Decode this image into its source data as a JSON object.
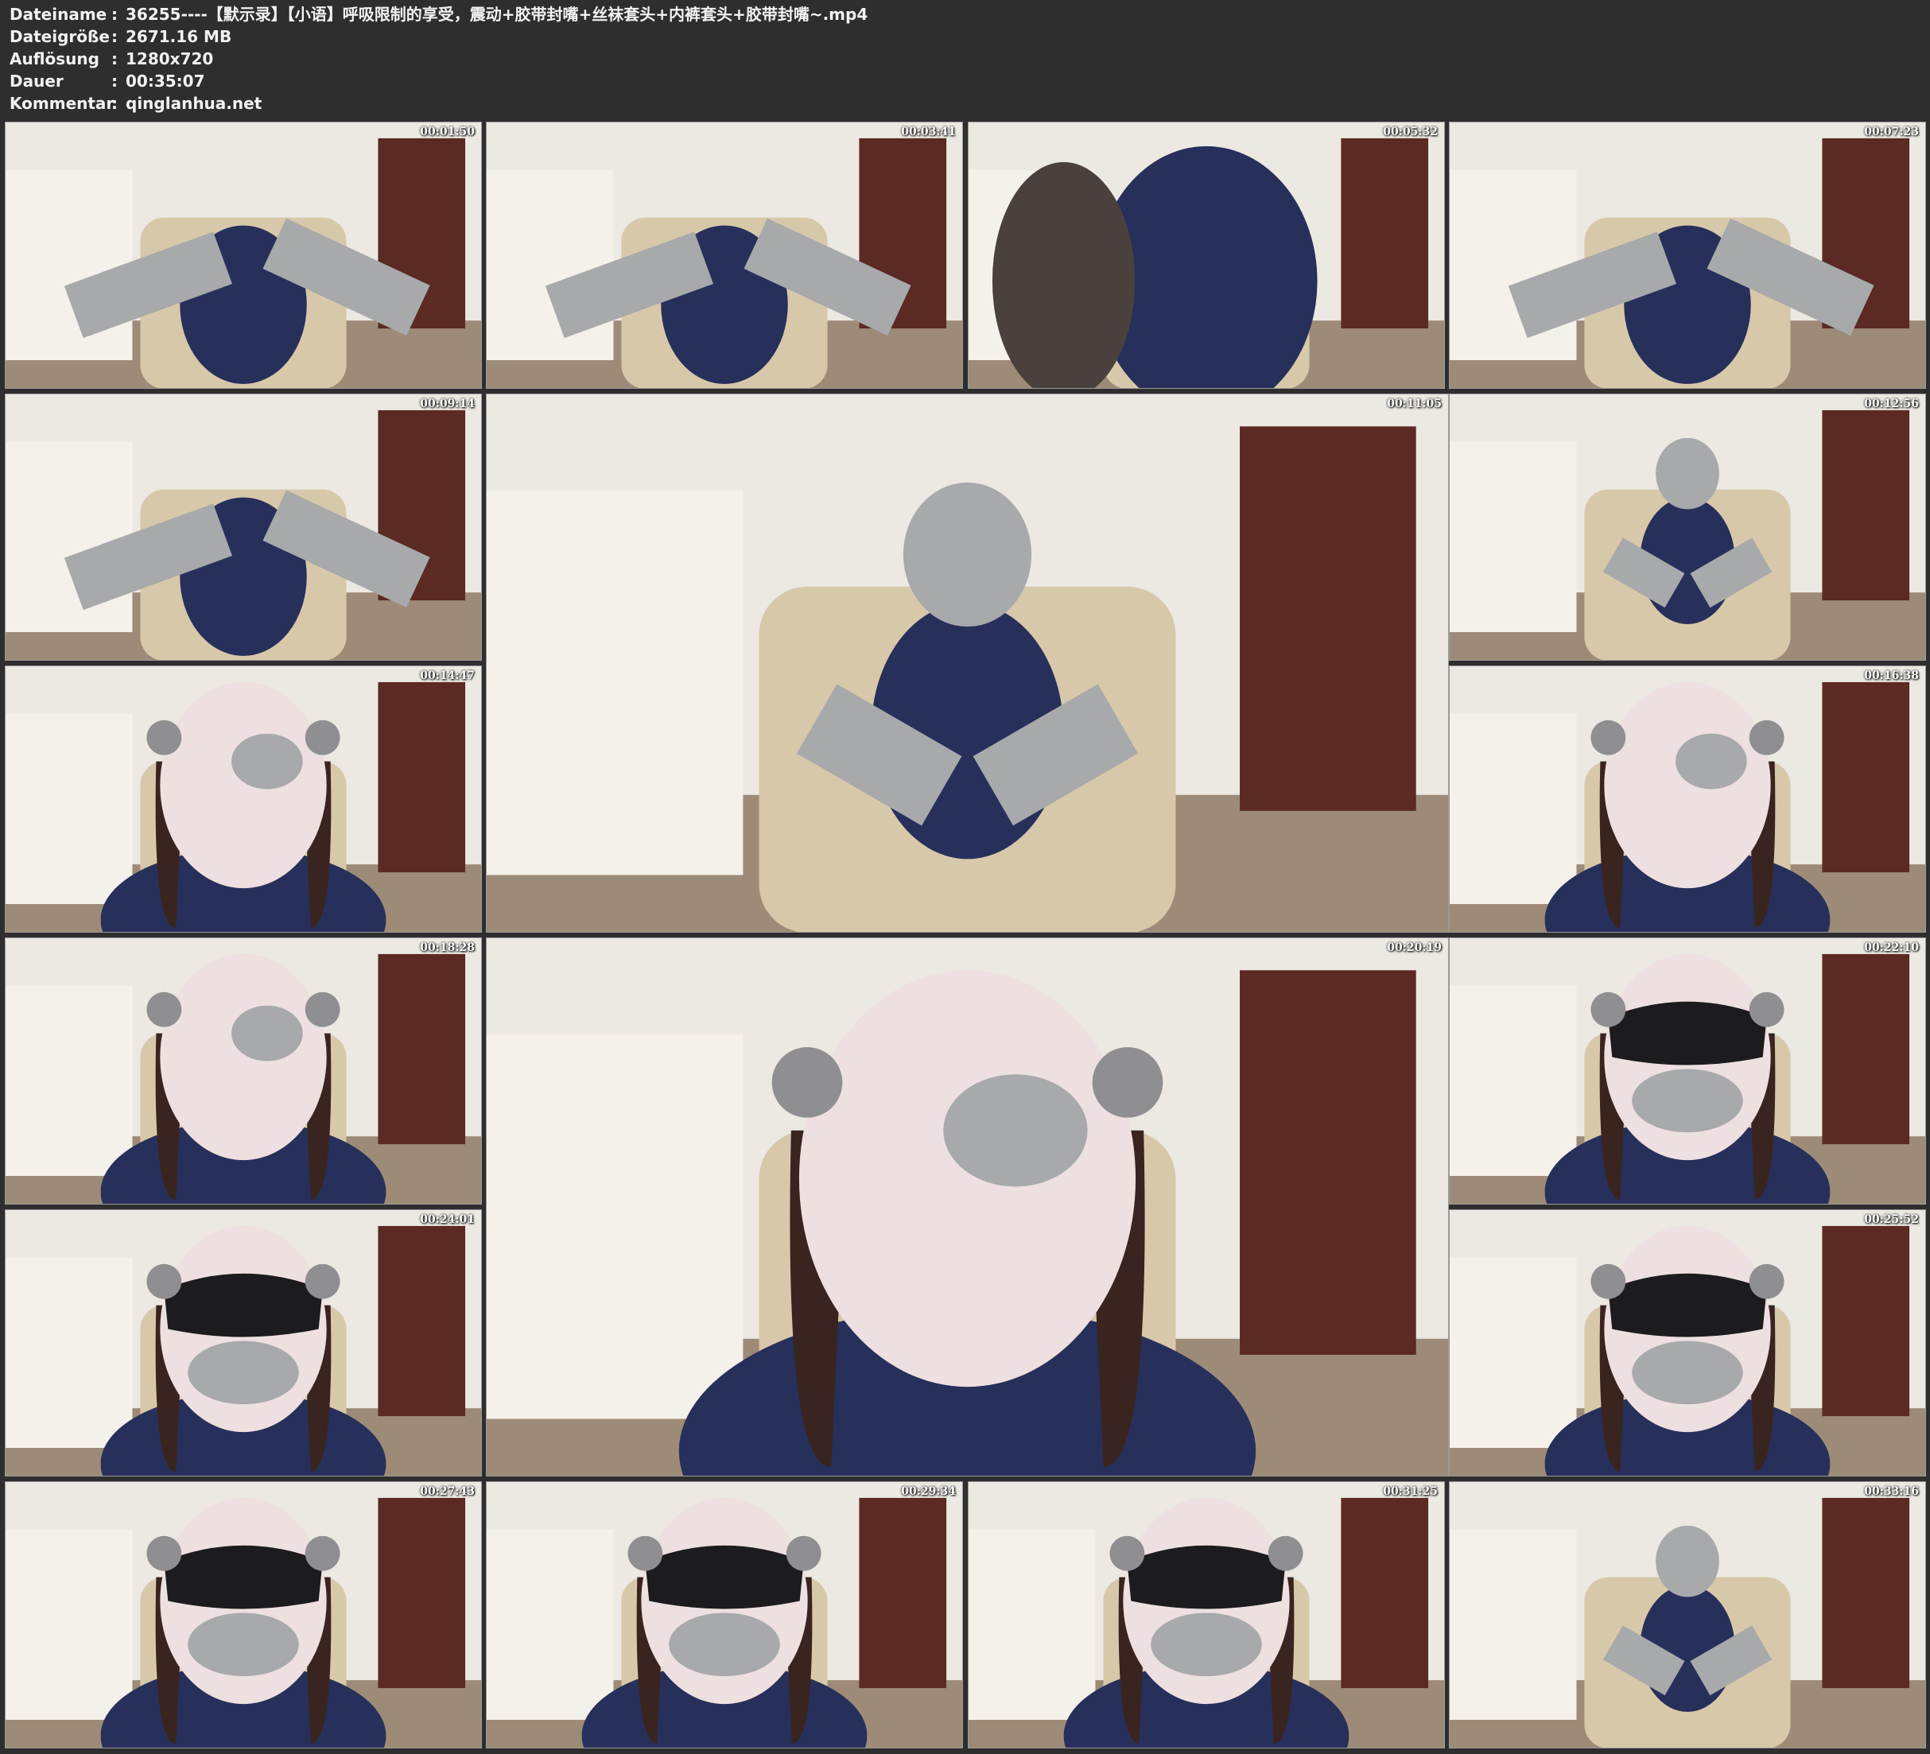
{
  "info": {
    "rows": [
      {
        "label": "Dateiname",
        "value": "36255----【默示录】【小语】呼吸限制的享受，震动+胶带封嘴+丝袜套头+内裤套头+胶带封嘴~.mp4"
      },
      {
        "label": "Dateigröße",
        "value": "2671.16 MB"
      },
      {
        "label": "Auflösung",
        "value": "1280x720"
      },
      {
        "label": "Dauer",
        "value": "00:35:07"
      },
      {
        "label": "Kommentar",
        "value": "qinglanhua.net"
      }
    ],
    "separator": ":"
  },
  "thumbnails": [
    {
      "timestamp": "00:01:50",
      "scene": "tape"
    },
    {
      "timestamp": "00:03:41",
      "scene": "tape"
    },
    {
      "timestamp": "00:05:32",
      "scene": "swimsuit"
    },
    {
      "timestamp": "00:07:23",
      "scene": "tape"
    },
    {
      "timestamp": "00:09:14",
      "scene": "tape"
    },
    {
      "timestamp": "00:11:05",
      "scene": "room"
    },
    {
      "timestamp": "00:12:56",
      "scene": "room"
    },
    {
      "timestamp": "00:14:47",
      "scene": "hood"
    },
    {
      "timestamp": "00:16:38",
      "scene": "hood"
    },
    {
      "timestamp": "00:18:28",
      "scene": "hood"
    },
    {
      "timestamp": "00:20:19",
      "scene": "hood"
    },
    {
      "timestamp": "00:22:10",
      "scene": "mask"
    },
    {
      "timestamp": "00:24:01",
      "scene": "mask"
    },
    {
      "timestamp": "00:25:52",
      "scene": "mask"
    },
    {
      "timestamp": "00:27:43",
      "scene": "mask"
    },
    {
      "timestamp": "00:29:34",
      "scene": "mask"
    },
    {
      "timestamp": "00:31:25",
      "scene": "mask"
    },
    {
      "timestamp": "00:33:16",
      "scene": "room"
    }
  ],
  "colors": {
    "background": "#2e2e2e",
    "text": "#f2f2f2",
    "tape": "#a7a9ab",
    "swimsuit": "#27305a",
    "hood": "#eedfe0",
    "wall": "#ece8e2",
    "door": "#5a2a23",
    "floor": "#9d8b77"
  }
}
